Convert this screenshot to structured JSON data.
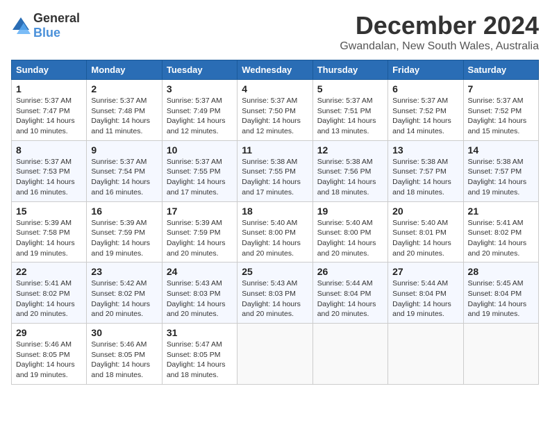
{
  "logo": {
    "general": "General",
    "blue": "Blue"
  },
  "header": {
    "month": "December 2024",
    "location": "Gwandalan, New South Wales, Australia"
  },
  "weekdays": [
    "Sunday",
    "Monday",
    "Tuesday",
    "Wednesday",
    "Thursday",
    "Friday",
    "Saturday"
  ],
  "weeks": [
    [
      {
        "day": "1",
        "sunrise": "5:37 AM",
        "sunset": "7:47 PM",
        "daylight": "14 hours and 10 minutes."
      },
      {
        "day": "2",
        "sunrise": "5:37 AM",
        "sunset": "7:48 PM",
        "daylight": "14 hours and 11 minutes."
      },
      {
        "day": "3",
        "sunrise": "5:37 AM",
        "sunset": "7:49 PM",
        "daylight": "14 hours and 12 minutes."
      },
      {
        "day": "4",
        "sunrise": "5:37 AM",
        "sunset": "7:50 PM",
        "daylight": "14 hours and 12 minutes."
      },
      {
        "day": "5",
        "sunrise": "5:37 AM",
        "sunset": "7:51 PM",
        "daylight": "14 hours and 13 minutes."
      },
      {
        "day": "6",
        "sunrise": "5:37 AM",
        "sunset": "7:52 PM",
        "daylight": "14 hours and 14 minutes."
      },
      {
        "day": "7",
        "sunrise": "5:37 AM",
        "sunset": "7:52 PM",
        "daylight": "14 hours and 15 minutes."
      }
    ],
    [
      {
        "day": "8",
        "sunrise": "5:37 AM",
        "sunset": "7:53 PM",
        "daylight": "14 hours and 16 minutes."
      },
      {
        "day": "9",
        "sunrise": "5:37 AM",
        "sunset": "7:54 PM",
        "daylight": "14 hours and 16 minutes."
      },
      {
        "day": "10",
        "sunrise": "5:37 AM",
        "sunset": "7:55 PM",
        "daylight": "14 hours and 17 minutes."
      },
      {
        "day": "11",
        "sunrise": "5:38 AM",
        "sunset": "7:55 PM",
        "daylight": "14 hours and 17 minutes."
      },
      {
        "day": "12",
        "sunrise": "5:38 AM",
        "sunset": "7:56 PM",
        "daylight": "14 hours and 18 minutes."
      },
      {
        "day": "13",
        "sunrise": "5:38 AM",
        "sunset": "7:57 PM",
        "daylight": "14 hours and 18 minutes."
      },
      {
        "day": "14",
        "sunrise": "5:38 AM",
        "sunset": "7:57 PM",
        "daylight": "14 hours and 19 minutes."
      }
    ],
    [
      {
        "day": "15",
        "sunrise": "5:39 AM",
        "sunset": "7:58 PM",
        "daylight": "14 hours and 19 minutes."
      },
      {
        "day": "16",
        "sunrise": "5:39 AM",
        "sunset": "7:59 PM",
        "daylight": "14 hours and 19 minutes."
      },
      {
        "day": "17",
        "sunrise": "5:39 AM",
        "sunset": "7:59 PM",
        "daylight": "14 hours and 20 minutes."
      },
      {
        "day": "18",
        "sunrise": "5:40 AM",
        "sunset": "8:00 PM",
        "daylight": "14 hours and 20 minutes."
      },
      {
        "day": "19",
        "sunrise": "5:40 AM",
        "sunset": "8:00 PM",
        "daylight": "14 hours and 20 minutes."
      },
      {
        "day": "20",
        "sunrise": "5:40 AM",
        "sunset": "8:01 PM",
        "daylight": "14 hours and 20 minutes."
      },
      {
        "day": "21",
        "sunrise": "5:41 AM",
        "sunset": "8:02 PM",
        "daylight": "14 hours and 20 minutes."
      }
    ],
    [
      {
        "day": "22",
        "sunrise": "5:41 AM",
        "sunset": "8:02 PM",
        "daylight": "14 hours and 20 minutes."
      },
      {
        "day": "23",
        "sunrise": "5:42 AM",
        "sunset": "8:02 PM",
        "daylight": "14 hours and 20 minutes."
      },
      {
        "day": "24",
        "sunrise": "5:43 AM",
        "sunset": "8:03 PM",
        "daylight": "14 hours and 20 minutes."
      },
      {
        "day": "25",
        "sunrise": "5:43 AM",
        "sunset": "8:03 PM",
        "daylight": "14 hours and 20 minutes."
      },
      {
        "day": "26",
        "sunrise": "5:44 AM",
        "sunset": "8:04 PM",
        "daylight": "14 hours and 20 minutes."
      },
      {
        "day": "27",
        "sunrise": "5:44 AM",
        "sunset": "8:04 PM",
        "daylight": "14 hours and 19 minutes."
      },
      {
        "day": "28",
        "sunrise": "5:45 AM",
        "sunset": "8:04 PM",
        "daylight": "14 hours and 19 minutes."
      }
    ],
    [
      {
        "day": "29",
        "sunrise": "5:46 AM",
        "sunset": "8:05 PM",
        "daylight": "14 hours and 19 minutes."
      },
      {
        "day": "30",
        "sunrise": "5:46 AM",
        "sunset": "8:05 PM",
        "daylight": "14 hours and 18 minutes."
      },
      {
        "day": "31",
        "sunrise": "5:47 AM",
        "sunset": "8:05 PM",
        "daylight": "14 hours and 18 minutes."
      },
      null,
      null,
      null,
      null
    ]
  ],
  "labels": {
    "sunrise": "Sunrise:",
    "sunset": "Sunset:",
    "daylight": "Daylight:"
  }
}
